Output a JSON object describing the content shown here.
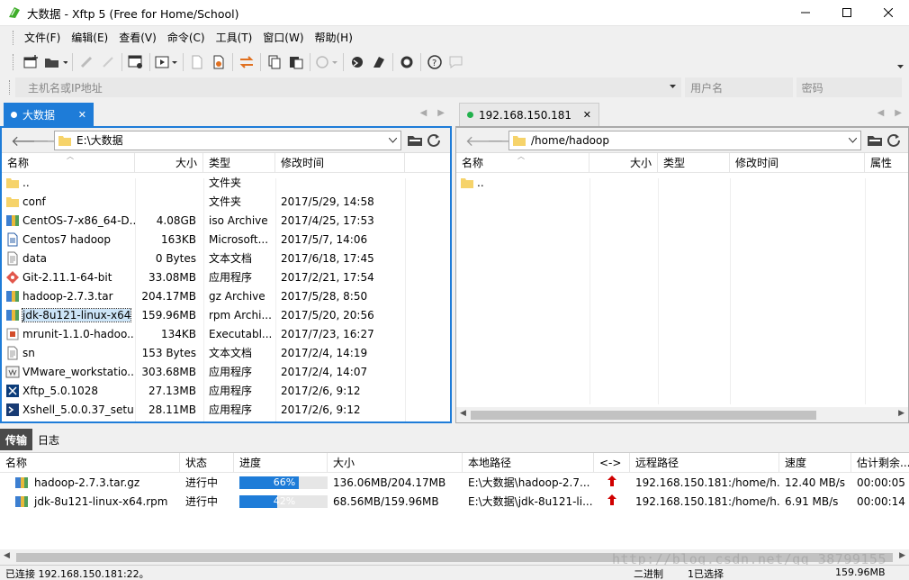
{
  "window": {
    "title": "大数据 - Xftp 5 (Free for Home/School)"
  },
  "menu": [
    "文件(F)",
    "编辑(E)",
    "查看(V)",
    "命令(C)",
    "工具(T)",
    "窗口(W)",
    "帮助(H)"
  ],
  "address": {
    "host_placeholder": "主机名或IP地址",
    "user_placeholder": "用户名",
    "password_placeholder": "密码"
  },
  "left": {
    "tab_label": "大数据",
    "path": "E:\\大数据",
    "columns": [
      "名称",
      "大小",
      "类型",
      "修改时间"
    ],
    "files": [
      {
        "name": "..",
        "size": "",
        "type": "文件夹",
        "modified": "",
        "icon": "folder-icon"
      },
      {
        "name": "conf",
        "size": "",
        "type": "文件夹",
        "modified": "2017/5/29, 14:58",
        "icon": "folder-icon"
      },
      {
        "name": "CentOS-7-x86_64-D...",
        "size": "4.08GB",
        "type": "iso Archive",
        "modified": "2017/4/25, 17:53",
        "icon": "archive-icon"
      },
      {
        "name": "Centos7 hadoop",
        "size": "163KB",
        "type": "Microsoft...",
        "modified": "2017/5/7, 14:06",
        "icon": "document-icon"
      },
      {
        "name": "data",
        "size": "0 Bytes",
        "type": "文本文档",
        "modified": "2017/6/18, 17:45",
        "icon": "text-file-icon"
      },
      {
        "name": "Git-2.11.1-64-bit",
        "size": "33.08MB",
        "type": "应用程序",
        "modified": "2017/2/21, 17:54",
        "icon": "git-icon"
      },
      {
        "name": "hadoop-2.7.3.tar",
        "size": "204.17MB",
        "type": "gz Archive",
        "modified": "2017/5/28, 8:50",
        "icon": "archive-icon"
      },
      {
        "name": "jdk-8u121-linux-x64",
        "size": "159.96MB",
        "type": "rpm Archi...",
        "modified": "2017/5/20, 20:56",
        "icon": "archive-icon"
      },
      {
        "name": "mrunit-1.1.0-hadoo...",
        "size": "134KB",
        "type": "Executabl...",
        "modified": "2017/7/23, 16:27",
        "icon": "jar-icon"
      },
      {
        "name": "sn",
        "size": "153 Bytes",
        "type": "文本文档",
        "modified": "2017/2/4, 14:19",
        "icon": "text-file-icon"
      },
      {
        "name": "VMware_workstatio...",
        "size": "303.68MB",
        "type": "应用程序",
        "modified": "2017/2/4, 14:07",
        "icon": "vmware-icon"
      },
      {
        "name": "Xftp_5.0.1028",
        "size": "27.13MB",
        "type": "应用程序",
        "modified": "2017/2/6, 9:12",
        "icon": "xftp-icon"
      },
      {
        "name": "Xshell_5.0.0.37_setu...",
        "size": "28.11MB",
        "type": "应用程序",
        "modified": "2017/2/6, 9:12",
        "icon": "xshell-icon"
      }
    ]
  },
  "right": {
    "tab_label": "192.168.150.181",
    "path": "/home/hadoop",
    "columns": [
      "名称",
      "大小",
      "类型",
      "修改时间",
      "属性"
    ],
    "files": [
      {
        "name": "..",
        "icon": "folder-icon"
      }
    ]
  },
  "bottom_tabs": [
    "传输",
    "日志"
  ],
  "transfers": {
    "columns": [
      "名称",
      "状态",
      "进度",
      "大小",
      "本地路径",
      "<->",
      "远程路径",
      "速度",
      "估计剩余..."
    ],
    "rows": [
      {
        "name": "hadoop-2.7.3.tar.gz",
        "status": "进行中",
        "progress": 66,
        "progress_label": "66%",
        "size": "136.06MB/204.17MB",
        "local": "E:\\大数据\\hadoop-2.7...",
        "remote": "192.168.150.181:/home/h...",
        "speed": "12.40 MB/s",
        "eta": "00:00:05"
      },
      {
        "name": "jdk-8u121-linux-x64.rpm",
        "status": "进行中",
        "progress": 42,
        "progress_label": "42%",
        "size": "68.56MB/159.96MB",
        "local": "E:\\大数据\\jdk-8u121-li...",
        "remote": "192.168.150.181:/home/h...",
        "speed": "6.91 MB/s",
        "eta": "00:00:14"
      }
    ]
  },
  "status": {
    "connection": "已连接 192.168.150.181:22。",
    "mode": "二进制",
    "selection": "1已选择",
    "size": "159.96MB"
  },
  "watermark": "http://blog.csdn.net/qq_38799155",
  "colors": {
    "accent": "#1e7cd8",
    "connected": "#22b14c",
    "upload_arrow": "#d00000"
  }
}
